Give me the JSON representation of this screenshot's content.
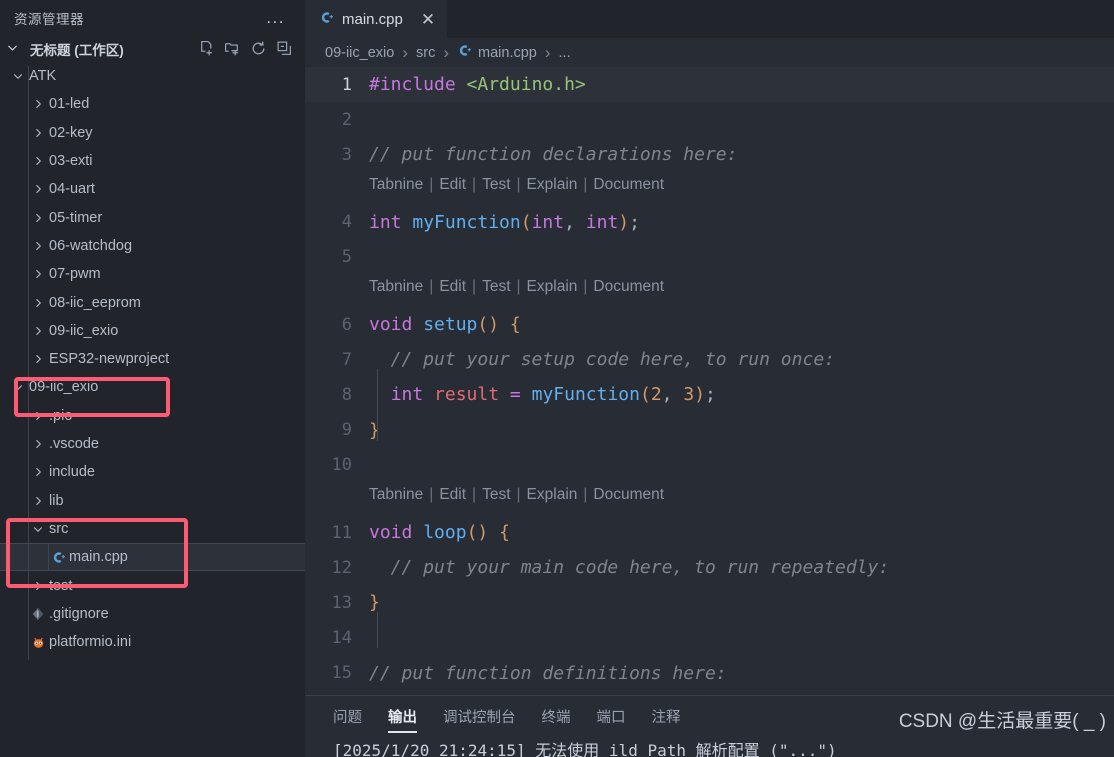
{
  "sidebar": {
    "title": "资源管理器",
    "more_label": "...",
    "workspace": {
      "label": "无标题 (工作区)"
    },
    "actions": [
      {
        "name": "new-file",
        "label": "新建文件"
      },
      {
        "name": "new-folder",
        "label": "新建文件夹"
      },
      {
        "name": "refresh",
        "label": "刷新"
      },
      {
        "name": "collapse-all",
        "label": "折叠文件夹"
      }
    ],
    "tree": [
      {
        "label": "ATK",
        "depth": 1,
        "type": "folder",
        "state": "expanded"
      },
      {
        "label": "01-led",
        "depth": 2,
        "type": "folder",
        "state": "collapsed"
      },
      {
        "label": "02-key",
        "depth": 2,
        "type": "folder",
        "state": "collapsed"
      },
      {
        "label": "03-exti",
        "depth": 2,
        "type": "folder",
        "state": "collapsed"
      },
      {
        "label": "04-uart",
        "depth": 2,
        "type": "folder",
        "state": "collapsed"
      },
      {
        "label": "05-timer",
        "depth": 2,
        "type": "folder",
        "state": "collapsed"
      },
      {
        "label": "06-watchdog",
        "depth": 2,
        "type": "folder",
        "state": "collapsed"
      },
      {
        "label": "07-pwm",
        "depth": 2,
        "type": "folder",
        "state": "collapsed"
      },
      {
        "label": "08-iic_eeprom",
        "depth": 2,
        "type": "folder",
        "state": "collapsed"
      },
      {
        "label": "09-iic_exio",
        "depth": 2,
        "type": "folder",
        "state": "collapsed"
      },
      {
        "label": "ESP32-newproject",
        "depth": 2,
        "type": "folder",
        "state": "collapsed"
      },
      {
        "label": "09-iic_exio",
        "depth": 1,
        "type": "folder",
        "state": "expanded",
        "highlight": true
      },
      {
        "label": ".pio",
        "depth": 2,
        "type": "folder",
        "state": "collapsed"
      },
      {
        "label": ".vscode",
        "depth": 2,
        "type": "folder",
        "state": "collapsed"
      },
      {
        "label": "include",
        "depth": 2,
        "type": "folder",
        "state": "collapsed"
      },
      {
        "label": "lib",
        "depth": 2,
        "type": "folder",
        "state": "collapsed"
      },
      {
        "label": "src",
        "depth": 2,
        "type": "folder",
        "state": "expanded",
        "highlight": true
      },
      {
        "label": "main.cpp",
        "depth": 3,
        "type": "cpp-file",
        "selected": true,
        "highlight": true
      },
      {
        "label": "test",
        "depth": 2,
        "type": "folder",
        "state": "collapsed"
      },
      {
        "label": ".gitignore",
        "depth": 2,
        "type": "git-file"
      },
      {
        "label": "platformio.ini",
        "depth": 2,
        "type": "platformio-file"
      }
    ]
  },
  "editor": {
    "tab": {
      "label": "main.cpp",
      "icon": "cpp-icon",
      "close_label": "✕"
    },
    "breadcrumb": [
      {
        "label": "09-iic_exio"
      },
      {
        "label": "src"
      },
      {
        "label": "main.cpp",
        "icon": "cpp-icon"
      },
      {
        "label": "..."
      }
    ],
    "codelens_label": {
      "items": [
        "Tabnine",
        "Edit",
        "Test",
        "Explain",
        "Document"
      ],
      "separator": "|"
    },
    "lines": [
      {
        "no": "1",
        "current": true,
        "tokens": [
          {
            "t": "#include",
            "c": "pp"
          },
          {
            "t": " ",
            "c": "def"
          },
          {
            "t": "<Arduino.h>",
            "c": "str"
          }
        ]
      },
      {
        "no": "2",
        "tokens": []
      },
      {
        "no": "3",
        "tokens": [
          {
            "t": "// put function declarations here:",
            "c": "com"
          }
        ]
      },
      {
        "no": "4",
        "tokens": [
          {
            "t": "int",
            "c": "kw"
          },
          {
            "t": " ",
            "c": "def"
          },
          {
            "t": "myFunction",
            "c": "fn"
          },
          {
            "t": "(",
            "c": "punc"
          },
          {
            "t": "int",
            "c": "kw"
          },
          {
            "t": ", ",
            "c": "def"
          },
          {
            "t": "int",
            "c": "kw"
          },
          {
            "t": ")",
            "c": "punc"
          },
          {
            "t": ";",
            "c": "def"
          }
        ]
      },
      {
        "no": "5",
        "tokens": []
      },
      {
        "no": "6",
        "tokens": [
          {
            "t": "void",
            "c": "kw"
          },
          {
            "t": " ",
            "c": "def"
          },
          {
            "t": "setup",
            "c": "fn"
          },
          {
            "t": "()",
            "c": "punc"
          },
          {
            "t": " ",
            "c": "def"
          },
          {
            "t": "{",
            "c": "punc"
          }
        ]
      },
      {
        "no": "7",
        "tokens": [
          {
            "t": "  // put your setup code here, to run once:",
            "c": "com"
          }
        ]
      },
      {
        "no": "8",
        "tokens": [
          {
            "t": "  ",
            "c": "def"
          },
          {
            "t": "int",
            "c": "kw"
          },
          {
            "t": " ",
            "c": "def"
          },
          {
            "t": "result",
            "c": "var"
          },
          {
            "t": " ",
            "c": "def"
          },
          {
            "t": "=",
            "c": "op"
          },
          {
            "t": " ",
            "c": "def"
          },
          {
            "t": "myFunction",
            "c": "fn"
          },
          {
            "t": "(",
            "c": "punc"
          },
          {
            "t": "2",
            "c": "num"
          },
          {
            "t": ", ",
            "c": "def"
          },
          {
            "t": "3",
            "c": "num"
          },
          {
            "t": ")",
            "c": "punc"
          },
          {
            "t": ";",
            "c": "def"
          }
        ]
      },
      {
        "no": "9",
        "tokens": [
          {
            "t": "}",
            "c": "punc"
          }
        ]
      },
      {
        "no": "10",
        "tokens": []
      },
      {
        "no": "11",
        "tokens": [
          {
            "t": "void",
            "c": "kw"
          },
          {
            "t": " ",
            "c": "def"
          },
          {
            "t": "loop",
            "c": "fn"
          },
          {
            "t": "()",
            "c": "punc"
          },
          {
            "t": " ",
            "c": "def"
          },
          {
            "t": "{",
            "c": "punc"
          }
        ]
      },
      {
        "no": "12",
        "tokens": [
          {
            "t": "  // put your main code here, to run repeatedly:",
            "c": "com"
          }
        ]
      },
      {
        "no": "13",
        "tokens": [
          {
            "t": "}",
            "c": "punc"
          }
        ]
      },
      {
        "no": "14",
        "tokens": []
      },
      {
        "no": "15",
        "tokens": [
          {
            "t": "// put function definitions here:",
            "c": "com"
          }
        ]
      }
    ]
  },
  "panel": {
    "tabs": [
      {
        "label": "问题",
        "active": false
      },
      {
        "label": "输出",
        "active": true
      },
      {
        "label": "调试控制台",
        "active": false
      },
      {
        "label": "终端",
        "active": false
      },
      {
        "label": "端口",
        "active": false
      },
      {
        "label": "注释",
        "active": false
      }
    ],
    "output_line": "[2025/1/20 21:24:15] 无法使用      ild_Path 解析配置 (\"...\")"
  },
  "watermark": "CSDN @生活最重要(    _    )",
  "colors": {
    "sidebar_bg": "#21252b",
    "editor_bg": "#282c34",
    "selection_bg": "#2c313a",
    "annotation": "#fb5b73",
    "keyword": "#c678dd",
    "function": "#61afef",
    "string": "#98c379",
    "comment": "#7f848e",
    "bracket": "#d19a66",
    "variable": "#e06c75"
  }
}
